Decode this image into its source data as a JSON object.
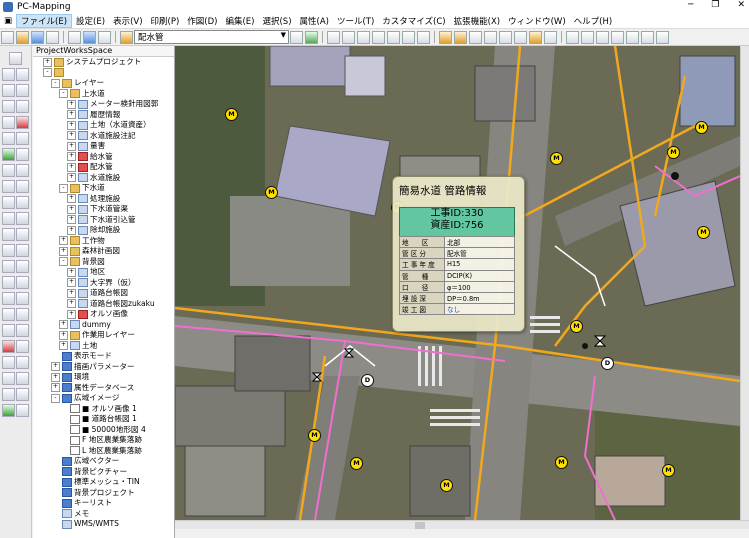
{
  "window": {
    "title": "PC-Mapping",
    "controls": [
      "─",
      "❐",
      "✕"
    ]
  },
  "menu": [
    {
      "label": "ファイル(E)",
      "active": true
    },
    {
      "label": "設定(E)"
    },
    {
      "label": "表示(V)"
    },
    {
      "label": "印刷(P)"
    },
    {
      "label": "作図(D)"
    },
    {
      "label": "編集(E)"
    },
    {
      "label": "選択(S)"
    },
    {
      "label": "属性(A)"
    },
    {
      "label": "ツール(T)"
    },
    {
      "label": "カスタマイズ(C)"
    },
    {
      "label": "拡張機能(X)"
    },
    {
      "label": "ウィンドウ(W)"
    },
    {
      "label": "ヘルプ(H)"
    }
  ],
  "toolbar": {
    "layer_select": "配水管"
  },
  "tree": {
    "header": "ProjectWorksSpace",
    "nodes": [
      {
        "label": "システムプロジェクト",
        "indent": 1,
        "exp": "+",
        "icon": "folder"
      },
      {
        "label": "",
        "indent": 1,
        "exp": "-",
        "icon": "folder"
      },
      {
        "label": "レイヤー",
        "indent": 2,
        "exp": "-",
        "icon": "folder"
      },
      {
        "label": "上水道",
        "indent": 3,
        "exp": "-",
        "icon": "folder"
      },
      {
        "label": "メーター検針用図郭",
        "indent": 4,
        "exp": "+",
        "icon": "layer"
      },
      {
        "label": "履歴情報",
        "indent": 4,
        "exp": "+",
        "icon": "layer"
      },
      {
        "label": "土地（水道資産）",
        "indent": 4,
        "exp": "+",
        "icon": "layer"
      },
      {
        "label": "水道施設注記",
        "indent": 4,
        "exp": "+",
        "icon": "layer"
      },
      {
        "label": "量害",
        "indent": 4,
        "exp": "+",
        "icon": "layer"
      },
      {
        "label": "給水管",
        "indent": 4,
        "exp": "+",
        "icon": "red"
      },
      {
        "label": "配水管",
        "indent": 4,
        "exp": "+",
        "icon": "red"
      },
      {
        "label": "水道施設",
        "indent": 4,
        "exp": "+",
        "icon": "layer"
      },
      {
        "label": "下水道",
        "indent": 3,
        "exp": "-",
        "icon": "folder"
      },
      {
        "label": "処理施設",
        "indent": 4,
        "exp": "+",
        "icon": "layer"
      },
      {
        "label": "下水道管渠",
        "indent": 4,
        "exp": "+",
        "icon": "layer"
      },
      {
        "label": "下水道引込管",
        "indent": 4,
        "exp": "+",
        "icon": "layer"
      },
      {
        "label": "除却施設",
        "indent": 4,
        "exp": "+",
        "icon": "layer"
      },
      {
        "label": "工作物",
        "indent": 3,
        "exp": "+",
        "icon": "folder"
      },
      {
        "label": "森林計画図",
        "indent": 3,
        "exp": "+",
        "icon": "folder"
      },
      {
        "label": "背景図",
        "indent": 3,
        "exp": "-",
        "icon": "folder"
      },
      {
        "label": "地区",
        "indent": 4,
        "exp": "+",
        "icon": "layer"
      },
      {
        "label": "大字界（仮）",
        "indent": 4,
        "exp": "+",
        "icon": "layer"
      },
      {
        "label": "道路台帳図",
        "indent": 4,
        "exp": "+",
        "icon": "layer"
      },
      {
        "label": "道路台帳図zukaku",
        "indent": 4,
        "exp": "+",
        "icon": "layer"
      },
      {
        "label": "オルソ画像",
        "indent": 4,
        "exp": "+",
        "icon": "red"
      },
      {
        "label": "dummy",
        "indent": 3,
        "exp": "+",
        "icon": "layer"
      },
      {
        "label": "作業用レイヤー",
        "indent": 3,
        "exp": "+",
        "icon": "folder"
      },
      {
        "label": "土地",
        "indent": 3,
        "exp": "+",
        "icon": "layer"
      },
      {
        "label": "表示モード",
        "indent": 2,
        "exp": "",
        "icon": "blue"
      },
      {
        "label": "描画パラメーター",
        "indent": 2,
        "exp": "+",
        "icon": "blue"
      },
      {
        "label": "環境",
        "indent": 2,
        "exp": "+",
        "icon": "blue"
      },
      {
        "label": "属性データベース",
        "indent": 2,
        "exp": "+",
        "icon": "blue"
      },
      {
        "label": "広域イメージ",
        "indent": 2,
        "exp": "-",
        "icon": "blue"
      },
      {
        "label": "■ オルソ画像 1",
        "indent": 3,
        "exp": "",
        "icon": "chk"
      },
      {
        "label": "■ 道路台帳図 1",
        "indent": 3,
        "exp": "",
        "icon": "chk"
      },
      {
        "label": "■ 50000地形図 4",
        "indent": 3,
        "exp": "",
        "icon": "chk"
      },
      {
        "label": "F     地区農業集落跡",
        "indent": 3,
        "exp": "",
        "icon": "chk"
      },
      {
        "label": "L     地区農業集落跡",
        "indent": 3,
        "exp": "",
        "icon": "chk"
      },
      {
        "label": "広域ベクター",
        "indent": 2,
        "exp": "",
        "icon": "blue"
      },
      {
        "label": "背景ピクチャー",
        "indent": 2,
        "exp": "",
        "icon": "blue"
      },
      {
        "label": "標準メッシュ・TIN",
        "indent": 2,
        "exp": "",
        "icon": "blue"
      },
      {
        "label": "背景プロジェクト",
        "indent": 2,
        "exp": "",
        "icon": "blue"
      },
      {
        "label": "キーリスト",
        "indent": 2,
        "exp": "",
        "icon": "blue"
      },
      {
        "label": "メモ",
        "indent": 2,
        "exp": "",
        "icon": "layer"
      },
      {
        "label": "WMS/WMTS",
        "indent": 2,
        "exp": "",
        "icon": "layer"
      }
    ]
  },
  "popup": {
    "title": "簡易水道 管路情報",
    "id_lines": [
      "工事ID:330",
      "資産ID:756"
    ],
    "rows": [
      {
        "k": "地　　区",
        "v": "北部"
      },
      {
        "k": "管 区 分",
        "v": "配水管"
      },
      {
        "k": "工 事 年 度",
        "v": "H15"
      },
      {
        "k": "管　　種",
        "v": "DCIP(K)"
      },
      {
        "k": "口　　径",
        "v": "φ＝100"
      },
      {
        "k": "埋 設 深",
        "v": "DP＝0.8m"
      },
      {
        "k": "竣 工 図",
        "v": "なし"
      }
    ]
  },
  "map": {
    "meter_markers": [
      {
        "l": "M"
      },
      {
        "l": "M"
      },
      {
        "l": "M"
      },
      {
        "l": "M"
      },
      {
        "l": "M"
      },
      {
        "l": "M"
      },
      {
        "l": "M"
      },
      {
        "l": "M"
      },
      {
        "l": "M"
      },
      {
        "l": "M"
      },
      {
        "l": "M"
      },
      {
        "l": "M"
      },
      {
        "l": "M"
      }
    ],
    "d_markers": [
      {
        "l": "D"
      },
      {
        "l": "D"
      }
    ],
    "colors": {
      "pipe_orange": "#f2a81d",
      "pipe_pink": "#f06fd0",
      "pipe_white": "#ffffff",
      "marker_yellow": "#ffe000",
      "id_box": "#62c7a0"
    }
  }
}
